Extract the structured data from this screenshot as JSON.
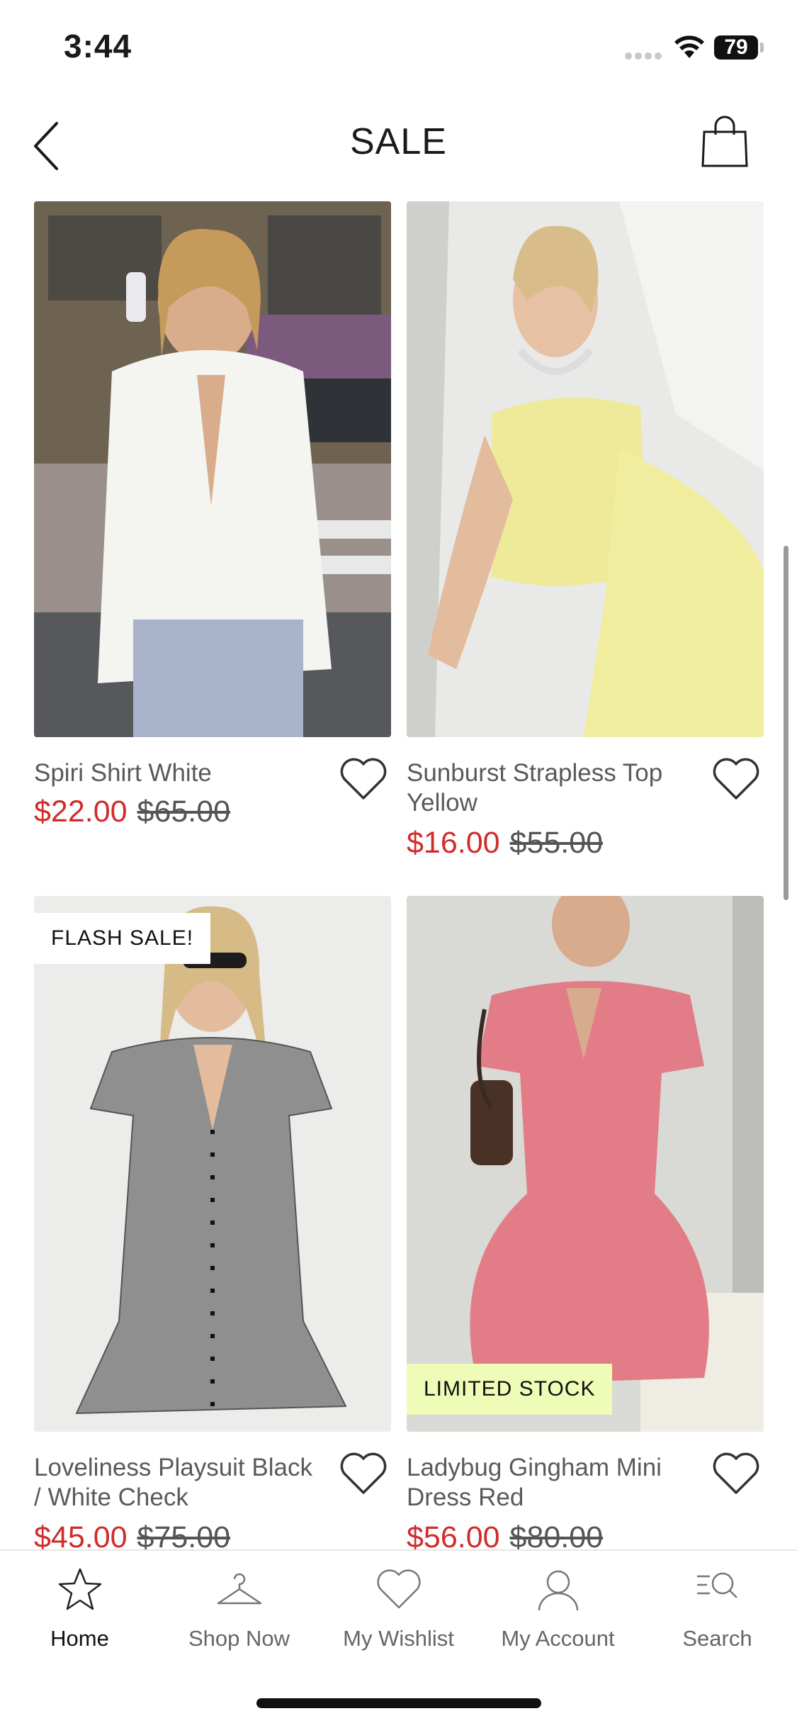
{
  "status_bar": {
    "time": "3:44",
    "battery": "79"
  },
  "header": {
    "title": "SALE"
  },
  "products": [
    {
      "name": "Spiri Shirt White",
      "price": "$22.00",
      "original_price": "$65.00",
      "badge": ""
    },
    {
      "name": "Sunburst Strapless Top Yellow",
      "price": "$16.00",
      "original_price": "$55.00",
      "badge": ""
    },
    {
      "name": "Loveliness Playsuit Black / White Check",
      "price": "$45.00",
      "original_price": "$75.00",
      "badge": "FLASH SALE!"
    },
    {
      "name": "Ladybug Gingham Mini Dress Red",
      "price": "$56.00",
      "original_price": "$80.00",
      "badge": "LIMITED STOCK"
    }
  ],
  "tabs": [
    {
      "label": "Home",
      "icon": "star-icon",
      "active": true
    },
    {
      "label": "Shop Now",
      "icon": "hanger-icon",
      "active": false
    },
    {
      "label": "My Wishlist",
      "icon": "heart-icon",
      "active": false
    },
    {
      "label": "My Account",
      "icon": "user-icon",
      "active": false
    },
    {
      "label": "Search",
      "icon": "search-list-icon",
      "active": false
    }
  ],
  "colors": {
    "sale_price": "#d12b2b",
    "limited_badge": "#eefcb8",
    "flash_badge": "#ffffff"
  }
}
